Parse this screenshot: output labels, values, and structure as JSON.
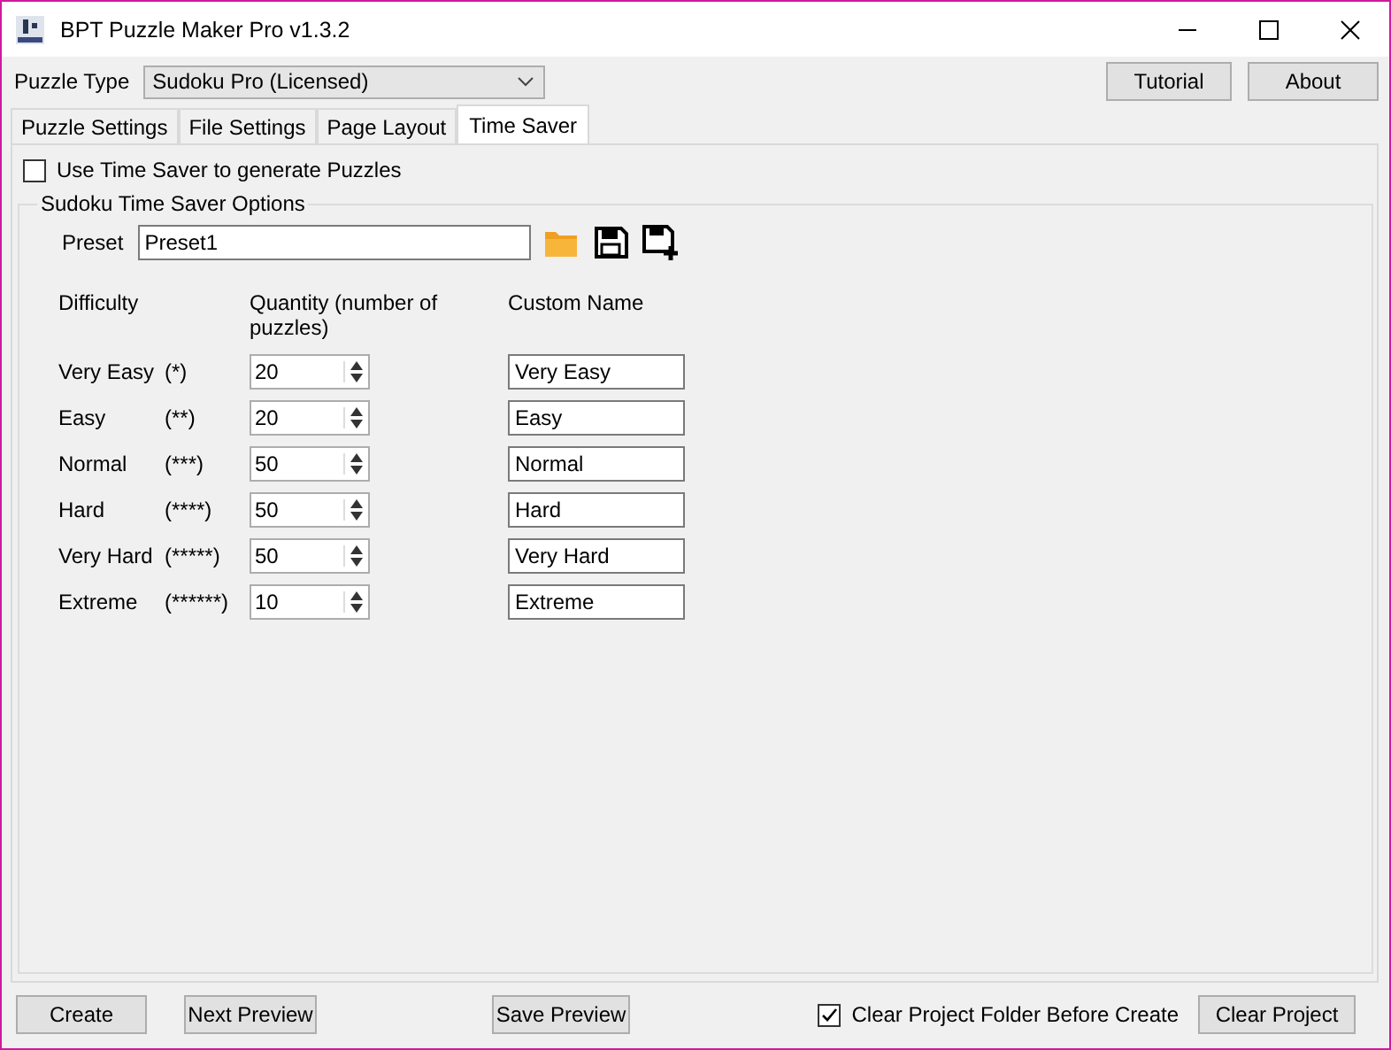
{
  "window": {
    "title": "BPT Puzzle Maker Pro v1.3.2"
  },
  "puzzle_type": {
    "label": "Puzzle Type",
    "value": "Sudoku Pro (Licensed)"
  },
  "top_buttons": [
    "Tutorial",
    "About"
  ],
  "tabs": [
    {
      "label": "Puzzle Settings",
      "selected": false
    },
    {
      "label": "File Settings",
      "selected": false
    },
    {
      "label": "Page Layout",
      "selected": false
    },
    {
      "label": "Time Saver",
      "selected": true
    }
  ],
  "use_time_saver": {
    "label": "Use Time Saver to generate Puzzles",
    "checked": false
  },
  "options": {
    "title": "Sudoku Time Saver Options",
    "preset_label": "Preset",
    "preset_value": "Preset1",
    "columns": [
      "Difficulty",
      "Quantity (number of puzzles)",
      "Custom Name"
    ],
    "rows": [
      {
        "difficulty": "Very Easy",
        "stars": "(*)",
        "quantity": "20",
        "custom_name": "Very Easy"
      },
      {
        "difficulty": "Easy",
        "stars": "(**)",
        "quantity": "20",
        "custom_name": "Easy"
      },
      {
        "difficulty": "Normal",
        "stars": "(***)",
        "quantity": "50",
        "custom_name": "Normal"
      },
      {
        "difficulty": "Hard",
        "stars": "(****)",
        "quantity": "50",
        "custom_name": "Hard"
      },
      {
        "difficulty": "Very Hard",
        "stars": "(*****)",
        "quantity": "50",
        "custom_name": "Very Hard"
      },
      {
        "difficulty": "Extreme",
        "stars": "(******)",
        "quantity": "10",
        "custom_name": "Extreme"
      }
    ]
  },
  "bottom": {
    "buttons_left": [
      "Create",
      "Next Preview",
      "Save Preview"
    ],
    "clear_folder": {
      "label": "Clear Project Folder Before Create",
      "checked": true
    },
    "clear_button": "Clear Project"
  }
}
